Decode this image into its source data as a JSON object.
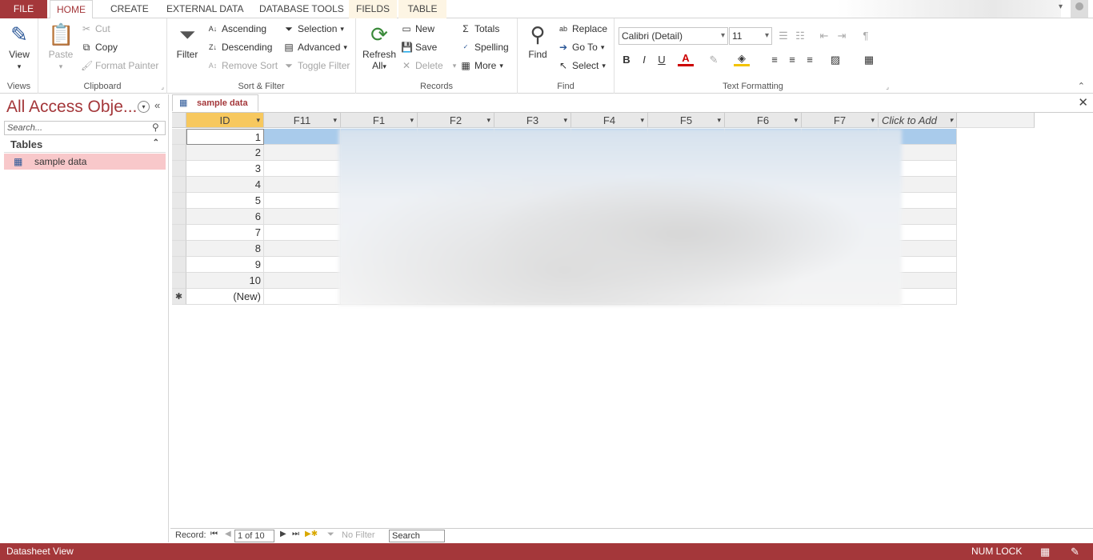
{
  "tabs": {
    "file": "FILE",
    "home": "HOME",
    "create": "CREATE",
    "external": "EXTERNAL DATA",
    "dbtools": "DATABASE TOOLS",
    "fields": "FIELDS",
    "table": "TABLE"
  },
  "ribbon": {
    "views": {
      "view": "View",
      "label": "Views"
    },
    "clipboard": {
      "paste": "Paste",
      "cut": "Cut",
      "copy": "Copy",
      "format_painter": "Format Painter",
      "label": "Clipboard"
    },
    "sortfilter": {
      "filter": "Filter",
      "ascending": "Ascending",
      "descending": "Descending",
      "remove_sort": "Remove Sort",
      "selection": "Selection",
      "advanced": "Advanced",
      "toggle_filter": "Toggle Filter",
      "label": "Sort & Filter"
    },
    "records": {
      "refresh": "Refresh",
      "refresh2": "All",
      "new": "New",
      "save": "Save",
      "delete": "Delete",
      "totals": "Totals",
      "spelling": "Spelling",
      "more": "More",
      "label": "Records"
    },
    "find": {
      "find": "Find",
      "replace": "Replace",
      "goto": "Go To",
      "select": "Select",
      "label": "Find"
    },
    "text": {
      "font": "Calibri (Detail)",
      "size": "11",
      "bold": "B",
      "italic": "I",
      "underline": "U",
      "label": "Text Formatting"
    }
  },
  "nav": {
    "title": "All Access Obje...",
    "search_placeholder": "Search...",
    "group": "Tables",
    "item": "sample data"
  },
  "doc": {
    "tab": "sample data"
  },
  "grid": {
    "columns": [
      "ID",
      "F11",
      "F1",
      "F2",
      "F3",
      "F4",
      "F5",
      "F6",
      "F7",
      "Click to Add"
    ],
    "rows": [
      "1",
      "2",
      "3",
      "4",
      "5",
      "6",
      "7",
      "8",
      "9",
      "10"
    ],
    "new_row": "(New)"
  },
  "recnav": {
    "label": "Record:",
    "position": "1 of 10",
    "filter": "No Filter",
    "search": "Search"
  },
  "status": {
    "view": "Datasheet View",
    "numlock": "NUM LOCK"
  },
  "colors": {
    "accent": "#a4373a",
    "selected_nav": "#f8c8ca",
    "header_active": "#f7c85e"
  }
}
